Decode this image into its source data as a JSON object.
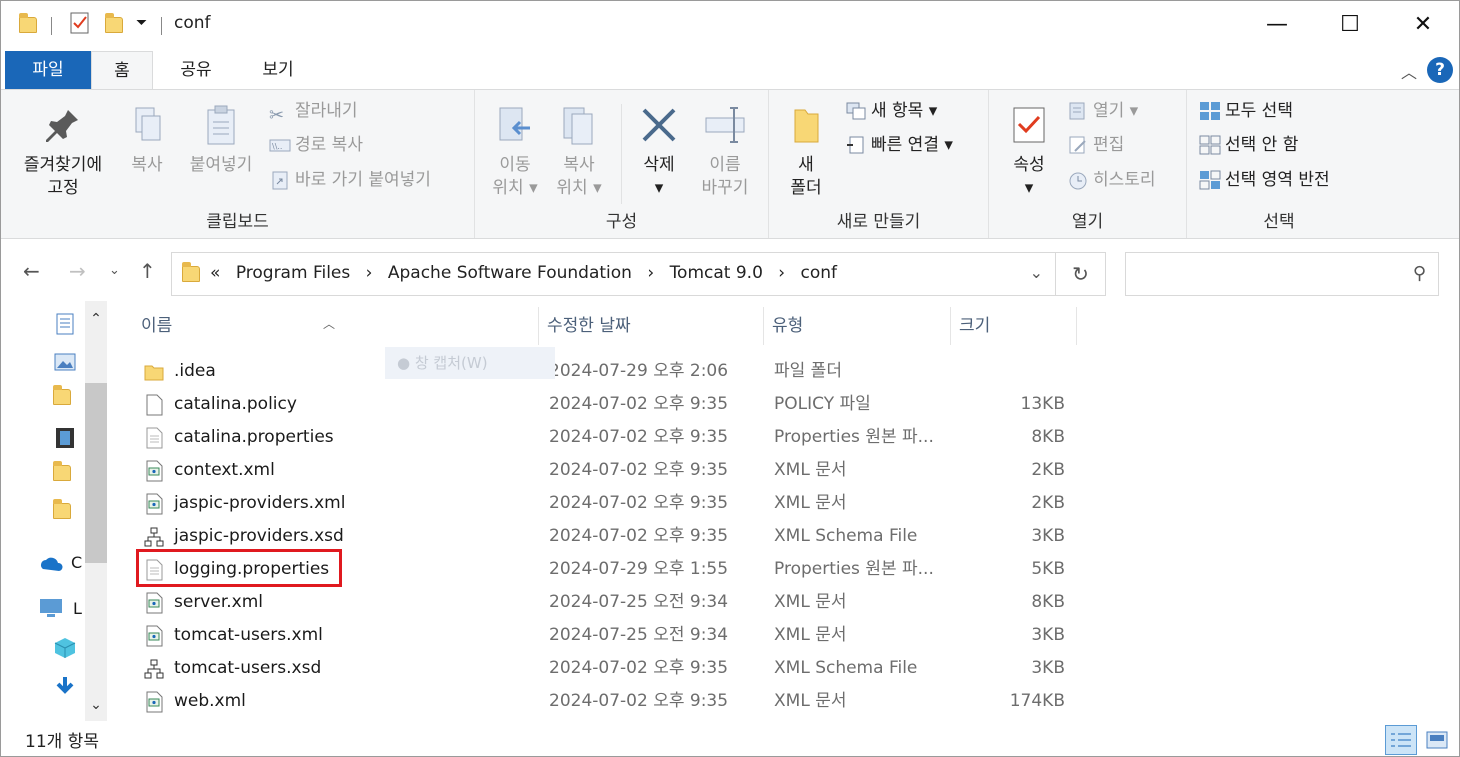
{
  "window": {
    "title": "conf",
    "controls": {
      "minimize": "—",
      "maximize": "☐",
      "close": "✕"
    }
  },
  "ribbon": {
    "tabs": [
      {
        "label": "파일"
      },
      {
        "label": "홈"
      },
      {
        "label": "공유"
      },
      {
        "label": "보기"
      }
    ],
    "clipboard": {
      "group_label": "클립보드",
      "pin_line1": "즐겨찾기에",
      "pin_line2": "고정",
      "copy": "복사",
      "paste": "붙여넣기",
      "cut": "잘라내기",
      "copy_path": "경로 복사",
      "paste_shortcut": "바로 가기 붙여넣기"
    },
    "organize": {
      "group_label": "구성",
      "move_line1": "이동",
      "move_line2": "위치",
      "copyto_line1": "복사",
      "copyto_line2": "위치",
      "delete": "삭제",
      "rename_line1": "이름",
      "rename_line2": "바꾸기"
    },
    "new": {
      "group_label": "새로 만들기",
      "folder_line1": "새",
      "folder_line2": "폴더",
      "new_item": "새 항목",
      "easy_access": "빠른 연결"
    },
    "open": {
      "group_label": "열기",
      "properties": "속성",
      "open": "열기",
      "edit": "편집",
      "history": "히스토리"
    },
    "select": {
      "group_label": "선택",
      "select_all": "모두 선택",
      "select_none": "선택 안 함",
      "invert": "선택 영역 반전"
    }
  },
  "address": {
    "overflow": "«",
    "crumbs": [
      "Program Files",
      "Apache Software Foundation",
      "Tomcat 9.0",
      "conf"
    ],
    "separator": "›",
    "search_placeholder": ""
  },
  "columns": {
    "name": "이름",
    "date": "수정한 날짜",
    "type": "유형",
    "size": "크기"
  },
  "ghost_text": "창 캡처(W)",
  "files": [
    {
      "name": ".idea",
      "date": "2024-07-29 오후 2:06",
      "type": "파일 폴더",
      "size": "",
      "icon": "folder-icon"
    },
    {
      "name": "catalina.policy",
      "date": "2024-07-02 오후 9:35",
      "type": "POLICY 파일",
      "size": "13KB",
      "icon": "blank-file-icon"
    },
    {
      "name": "catalina.properties",
      "date": "2024-07-02 오후 9:35",
      "type": "Properties 원본 파...",
      "size": "8KB",
      "icon": "text-file-icon"
    },
    {
      "name": "context.xml",
      "date": "2024-07-02 오후 9:35",
      "type": "XML 문서",
      "size": "2KB",
      "icon": "xml-file-icon"
    },
    {
      "name": "jaspic-providers.xml",
      "date": "2024-07-02 오후 9:35",
      "type": "XML 문서",
      "size": "2KB",
      "icon": "xml-file-icon"
    },
    {
      "name": "jaspic-providers.xsd",
      "date": "2024-07-02 오후 9:35",
      "type": "XML Schema File",
      "size": "3KB",
      "icon": "schema-file-icon"
    },
    {
      "name": "logging.properties",
      "date": "2024-07-29 오후 1:55",
      "type": "Properties 원본 파...",
      "size": "5KB",
      "icon": "text-file-icon"
    },
    {
      "name": "server.xml",
      "date": "2024-07-25 오전 9:34",
      "type": "XML 문서",
      "size": "8KB",
      "icon": "xml-file-icon"
    },
    {
      "name": "tomcat-users.xml",
      "date": "2024-07-25 오전 9:34",
      "type": "XML 문서",
      "size": "3KB",
      "icon": "xml-file-icon"
    },
    {
      "name": "tomcat-users.xsd",
      "date": "2024-07-02 오후 9:35",
      "type": "XML Schema File",
      "size": "3KB",
      "icon": "schema-file-icon"
    },
    {
      "name": "web.xml",
      "date": "2024-07-02 오후 9:35",
      "type": "XML 문서",
      "size": "174KB",
      "icon": "xml-file-icon"
    }
  ],
  "nav_pane_labels": {
    "onedrive": "C",
    "thispc": "L"
  },
  "status": {
    "item_count": "11개 항목"
  },
  "colors": {
    "accent": "#1a67b8",
    "highlight": "#e0191f"
  }
}
